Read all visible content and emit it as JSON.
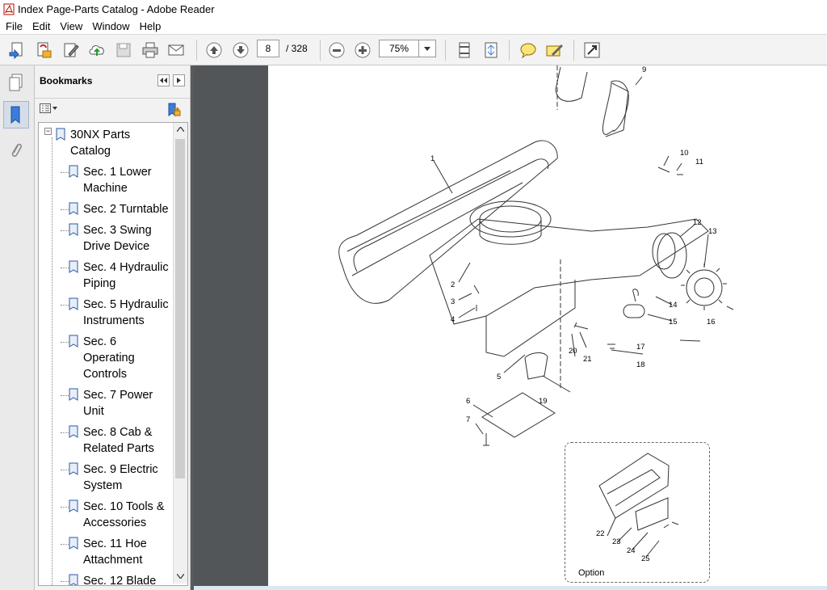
{
  "window": {
    "title": "Index Page-Parts Catalog - Adobe Reader"
  },
  "menu": [
    "File",
    "Edit",
    "View",
    "Window",
    "Help"
  ],
  "toolbar": {
    "page_current": "8",
    "page_total": "/ 328",
    "zoom": "75%",
    "icons": [
      "create-pdf-icon",
      "share-icon",
      "edit-icon",
      "cloud-upload-icon",
      "save-icon",
      "print-icon",
      "email-icon",
      "prev-page-icon",
      "next-page-icon",
      "zoom-out-icon",
      "zoom-in-icon",
      "single-page-icon",
      "fit-page-icon",
      "comment-icon",
      "sign-icon",
      "fullscreen-icon"
    ]
  },
  "bookmarks_panel": {
    "title": "Bookmarks",
    "root": "30NX Parts Catalog",
    "items": [
      "Sec. 1 Lower Machine",
      "Sec. 2 Turntable",
      "Sec. 3 Swing Drive Device",
      "Sec. 4 Hydraulic Piping",
      "Sec. 5 Hydraulic Instruments",
      "Sec. 6 Operating Controls",
      "Sec. 7 Power Unit",
      "Sec. 8 Cab & Related Parts",
      "Sec. 9 Electric System",
      "Sec. 10 Tools & Accessories",
      "Sec. 11 Hoe Attachment",
      "Sec. 12 Blade"
    ]
  },
  "diagram": {
    "callouts": [
      "1",
      "2",
      "3",
      "4",
      "5",
      "6",
      "7",
      "8",
      "9",
      "10",
      "11",
      "12",
      "13",
      "14",
      "15",
      "16",
      "17",
      "18",
      "19",
      "20",
      "21",
      "22",
      "23",
      "24",
      "25"
    ],
    "option_label": "Option"
  },
  "colors": {
    "doc_bg": "#525659",
    "accent": "#1f5ba8"
  }
}
